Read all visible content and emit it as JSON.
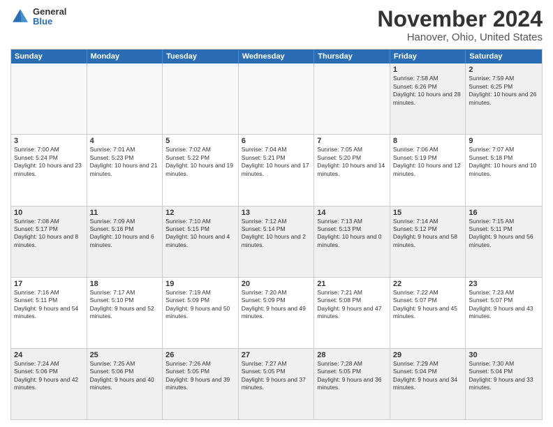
{
  "header": {
    "logo": {
      "general": "General",
      "blue": "Blue"
    },
    "title": "November 2024",
    "subtitle": "Hanover, Ohio, United States"
  },
  "weekdays": [
    "Sunday",
    "Monday",
    "Tuesday",
    "Wednesday",
    "Thursday",
    "Friday",
    "Saturday"
  ],
  "rows": [
    [
      {
        "day": "",
        "info": ""
      },
      {
        "day": "",
        "info": ""
      },
      {
        "day": "",
        "info": ""
      },
      {
        "day": "",
        "info": ""
      },
      {
        "day": "",
        "info": ""
      },
      {
        "day": "1",
        "info": "Sunrise: 7:58 AM\nSunset: 6:26 PM\nDaylight: 10 hours and 28 minutes."
      },
      {
        "day": "2",
        "info": "Sunrise: 7:59 AM\nSunset: 6:25 PM\nDaylight: 10 hours and 26 minutes."
      }
    ],
    [
      {
        "day": "3",
        "info": "Sunrise: 7:00 AM\nSunset: 5:24 PM\nDaylight: 10 hours and 23 minutes."
      },
      {
        "day": "4",
        "info": "Sunrise: 7:01 AM\nSunset: 5:23 PM\nDaylight: 10 hours and 21 minutes."
      },
      {
        "day": "5",
        "info": "Sunrise: 7:02 AM\nSunset: 5:22 PM\nDaylight: 10 hours and 19 minutes."
      },
      {
        "day": "6",
        "info": "Sunrise: 7:04 AM\nSunset: 5:21 PM\nDaylight: 10 hours and 17 minutes."
      },
      {
        "day": "7",
        "info": "Sunrise: 7:05 AM\nSunset: 5:20 PM\nDaylight: 10 hours and 14 minutes."
      },
      {
        "day": "8",
        "info": "Sunrise: 7:06 AM\nSunset: 5:19 PM\nDaylight: 10 hours and 12 minutes."
      },
      {
        "day": "9",
        "info": "Sunrise: 7:07 AM\nSunset: 5:18 PM\nDaylight: 10 hours and 10 minutes."
      }
    ],
    [
      {
        "day": "10",
        "info": "Sunrise: 7:08 AM\nSunset: 5:17 PM\nDaylight: 10 hours and 8 minutes."
      },
      {
        "day": "11",
        "info": "Sunrise: 7:09 AM\nSunset: 5:16 PM\nDaylight: 10 hours and 6 minutes."
      },
      {
        "day": "12",
        "info": "Sunrise: 7:10 AM\nSunset: 5:15 PM\nDaylight: 10 hours and 4 minutes."
      },
      {
        "day": "13",
        "info": "Sunrise: 7:12 AM\nSunset: 5:14 PM\nDaylight: 10 hours and 2 minutes."
      },
      {
        "day": "14",
        "info": "Sunrise: 7:13 AM\nSunset: 5:13 PM\nDaylight: 10 hours and 0 minutes."
      },
      {
        "day": "15",
        "info": "Sunrise: 7:14 AM\nSunset: 5:12 PM\nDaylight: 9 hours and 58 minutes."
      },
      {
        "day": "16",
        "info": "Sunrise: 7:15 AM\nSunset: 5:11 PM\nDaylight: 9 hours and 56 minutes."
      }
    ],
    [
      {
        "day": "17",
        "info": "Sunrise: 7:16 AM\nSunset: 5:11 PM\nDaylight: 9 hours and 54 minutes."
      },
      {
        "day": "18",
        "info": "Sunrise: 7:17 AM\nSunset: 5:10 PM\nDaylight: 9 hours and 52 minutes."
      },
      {
        "day": "19",
        "info": "Sunrise: 7:19 AM\nSunset: 5:09 PM\nDaylight: 9 hours and 50 minutes."
      },
      {
        "day": "20",
        "info": "Sunrise: 7:20 AM\nSunset: 5:09 PM\nDaylight: 9 hours and 49 minutes."
      },
      {
        "day": "21",
        "info": "Sunrise: 7:21 AM\nSunset: 5:08 PM\nDaylight: 9 hours and 47 minutes."
      },
      {
        "day": "22",
        "info": "Sunrise: 7:22 AM\nSunset: 5:07 PM\nDaylight: 9 hours and 45 minutes."
      },
      {
        "day": "23",
        "info": "Sunrise: 7:23 AM\nSunset: 5:07 PM\nDaylight: 9 hours and 43 minutes."
      }
    ],
    [
      {
        "day": "24",
        "info": "Sunrise: 7:24 AM\nSunset: 5:06 PM\nDaylight: 9 hours and 42 minutes."
      },
      {
        "day": "25",
        "info": "Sunrise: 7:25 AM\nSunset: 5:06 PM\nDaylight: 9 hours and 40 minutes."
      },
      {
        "day": "26",
        "info": "Sunrise: 7:26 AM\nSunset: 5:05 PM\nDaylight: 9 hours and 39 minutes."
      },
      {
        "day": "27",
        "info": "Sunrise: 7:27 AM\nSunset: 5:05 PM\nDaylight: 9 hours and 37 minutes."
      },
      {
        "day": "28",
        "info": "Sunrise: 7:28 AM\nSunset: 5:05 PM\nDaylight: 9 hours and 36 minutes."
      },
      {
        "day": "29",
        "info": "Sunrise: 7:29 AM\nSunset: 5:04 PM\nDaylight: 9 hours and 34 minutes."
      },
      {
        "day": "30",
        "info": "Sunrise: 7:30 AM\nSunset: 5:04 PM\nDaylight: 9 hours and 33 minutes."
      }
    ]
  ]
}
